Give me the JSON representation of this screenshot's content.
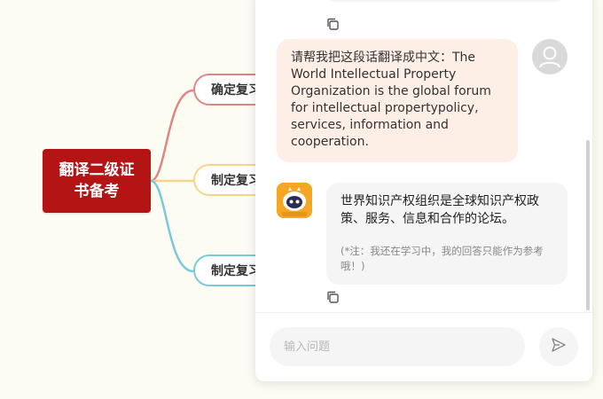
{
  "mindmap": {
    "root_label": "翻译二级证书备考",
    "branches": [
      {
        "label": "确定复习"
      },
      {
        "label": "制定复习"
      },
      {
        "label": "制定复习"
      }
    ]
  },
  "chat": {
    "user_message": "请帮我把这段话翻译成中文：The World Intellectual Property Organization is the global forum for intellectual propertypolicy, services, information and cooperation.",
    "bot_reply": "世界知识产权组织是全球知识产权政策、服务、信息和合作的论坛。",
    "bot_note": "(*注：我还在学习中，我的回答只能作为参考哦！)",
    "input_placeholder": "输入问题",
    "icons": {
      "copy": "copy-icon",
      "send": "send-icon",
      "user_avatar": "user-avatar-icon",
      "bot_avatar": "robot-avatar-icon"
    }
  },
  "colors": {
    "root": "#b41414",
    "branch_1": "#e08585",
    "branch_2": "#f5d58a",
    "branch_3": "#78c8de",
    "user_bubble": "#fdeee6",
    "bot_bubble": "#f5f5f5",
    "bot_avatar": "#f5a623"
  }
}
